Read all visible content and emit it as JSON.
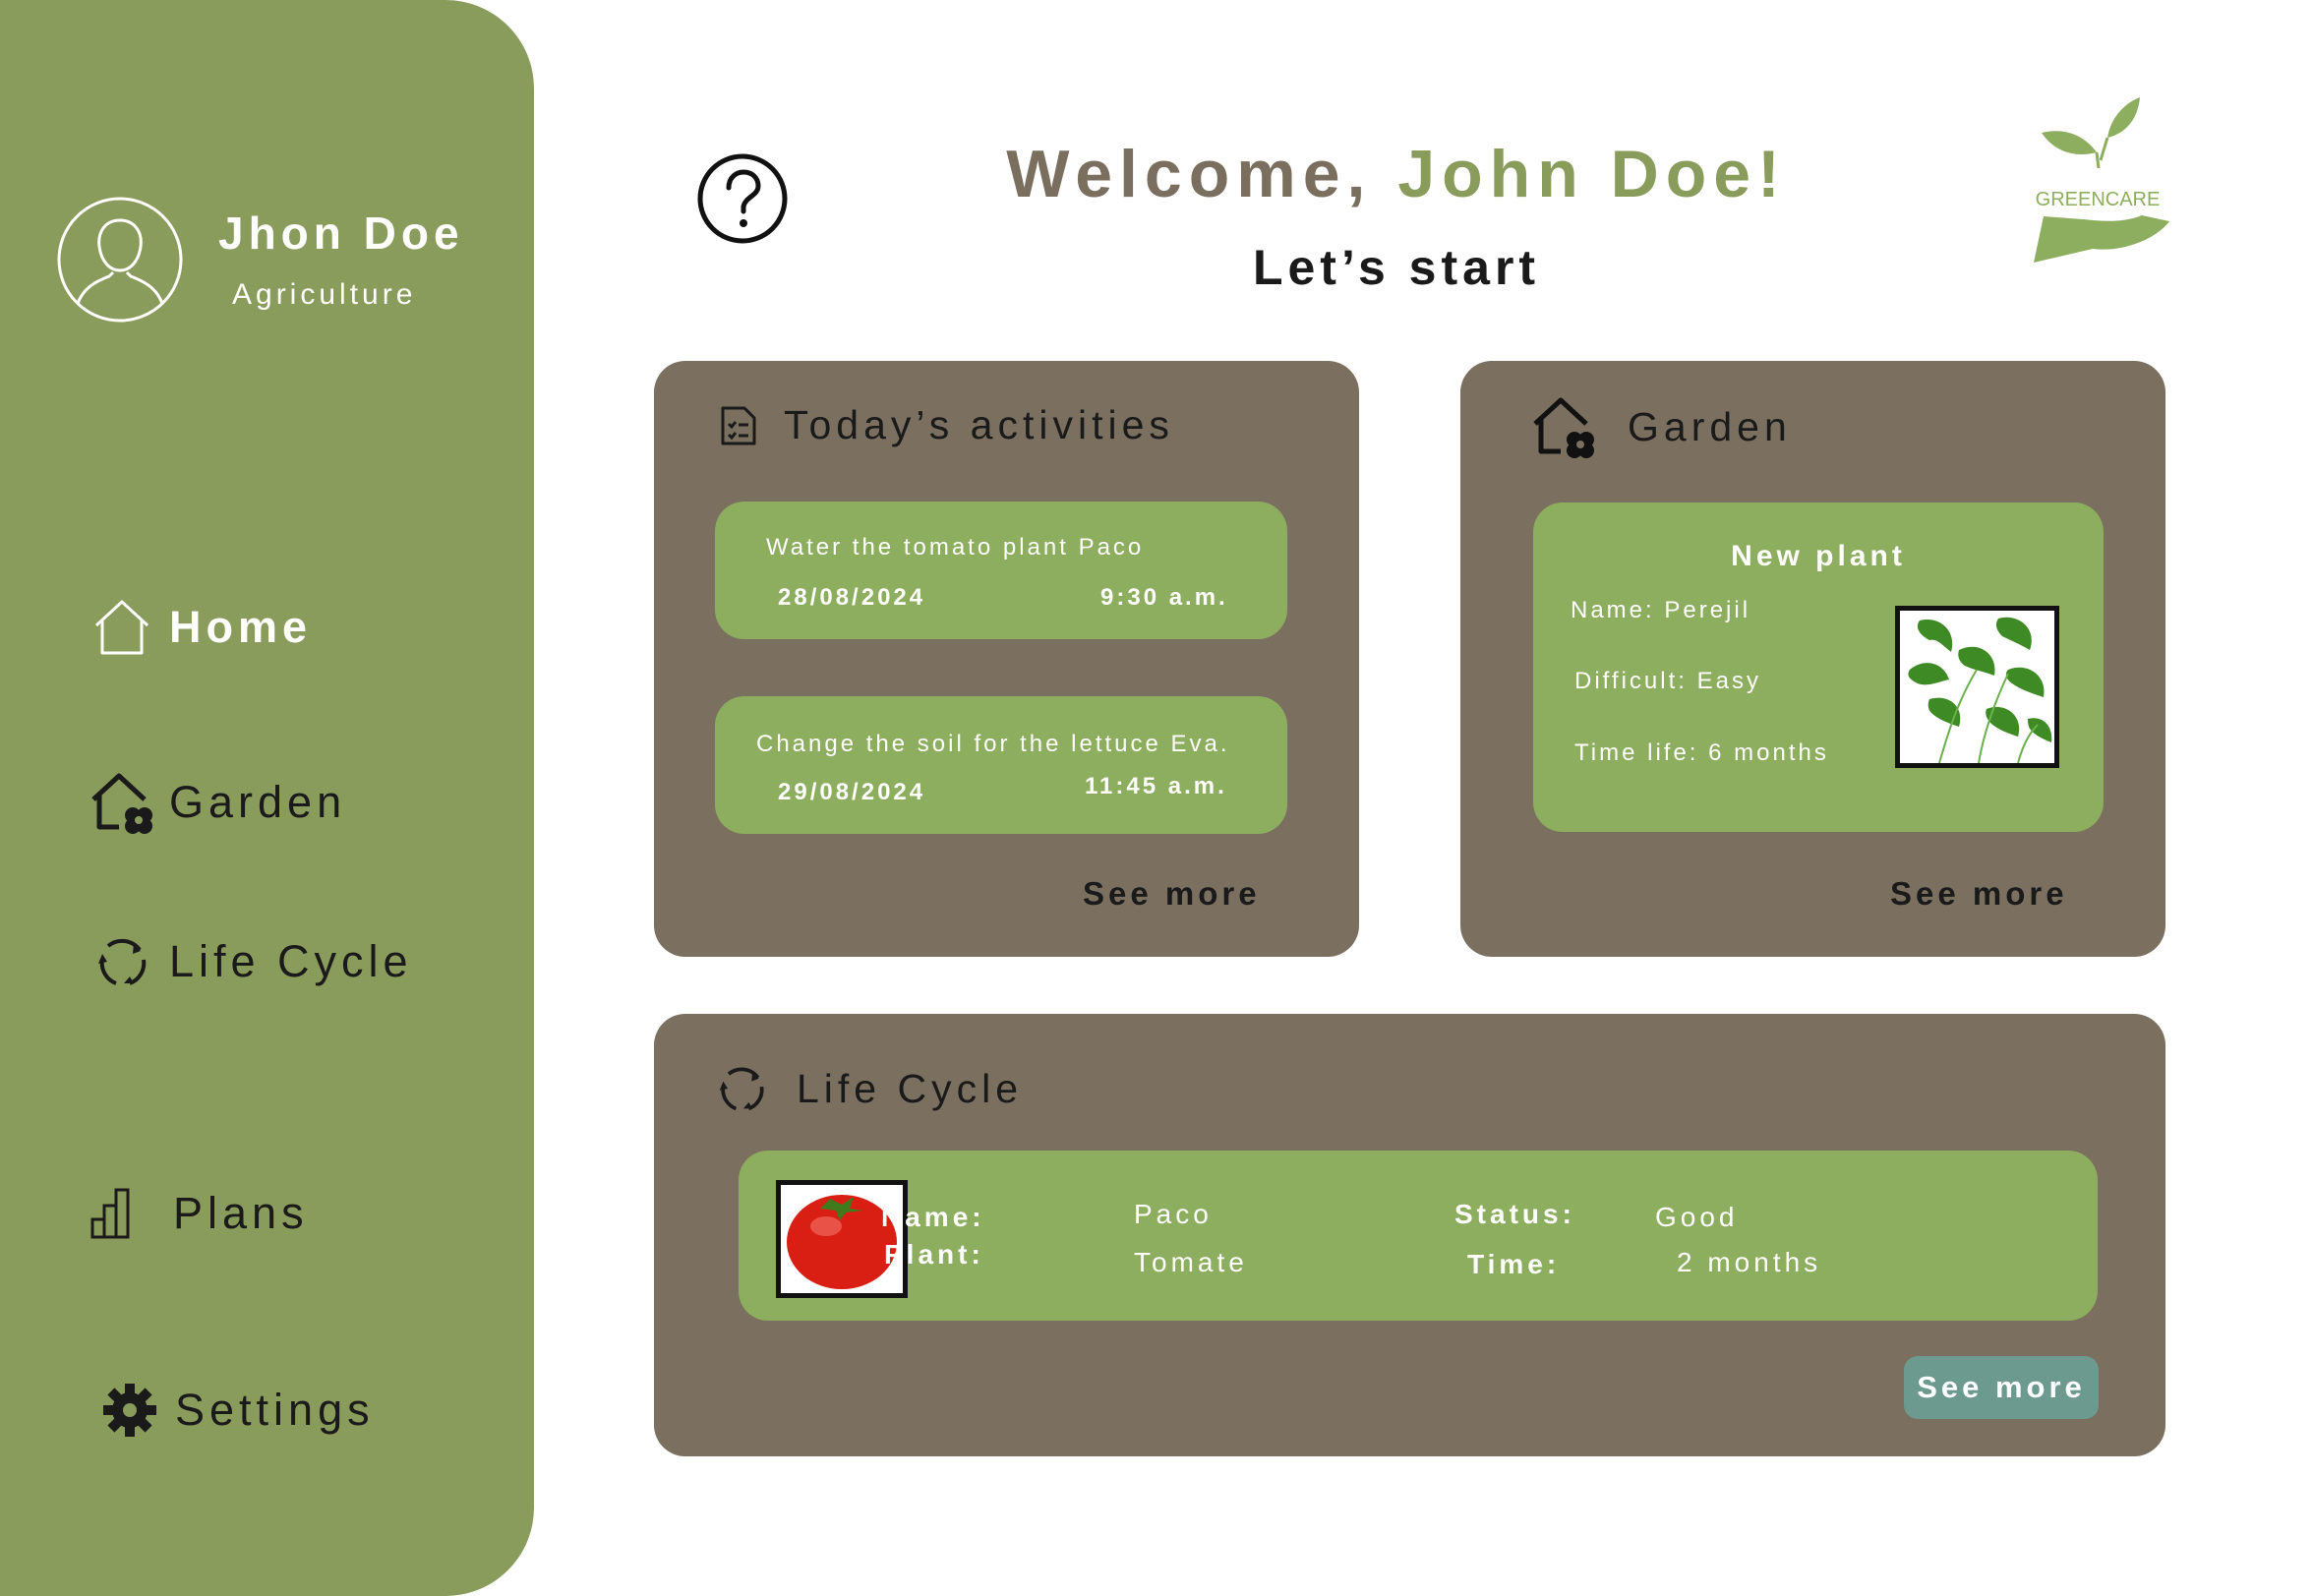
{
  "colors": {
    "sidebar": "#8a9c5b",
    "card": "#7b705f",
    "task": "#8dae5f",
    "accent": "#8a9c5b",
    "button": "#6c9a8e"
  },
  "sidebar": {
    "user": {
      "name": "Jhon Doe",
      "role": "Agriculture",
      "avatar_icon": "user-avatar-icon"
    },
    "items": [
      {
        "label": "Home",
        "icon": "home-icon",
        "active": true
      },
      {
        "label": "Garden",
        "icon": "garden-house-icon"
      },
      {
        "label": "Life Cycle",
        "icon": "recycle-icon"
      },
      {
        "label": "Plans",
        "icon": "bar-chart-icon"
      },
      {
        "label": "Settings",
        "icon": "gear-icon"
      }
    ]
  },
  "header": {
    "welcome_prefix": "Welcome, ",
    "welcome_name": "John Doe!",
    "subtitle": "Let’s start",
    "help_icon": "question-icon",
    "logo_text": "GREENCARE"
  },
  "activities": {
    "title": "Today’s activities",
    "icon": "checklist-icon",
    "tasks": [
      {
        "text": "Water the tomato plant Paco",
        "date": "28/08/2024",
        "time": "9:30 a.m."
      },
      {
        "text": "Change the soil for the lettuce Eva.",
        "date": "29/08/2024",
        "time": "11:45 a.m."
      }
    ],
    "see_more": "See more"
  },
  "garden": {
    "title": "Garden",
    "icon": "garden-house-icon",
    "new_plant": {
      "heading": "New plant",
      "name": "Name: Perejil",
      "difficulty": "Difficult: Easy",
      "time_life": "Time life: 6 months"
    },
    "see_more": "See more"
  },
  "life_cycle": {
    "title": "Life Cycle",
    "icon": "recycle-icon",
    "name_label": "Name:",
    "plant_label": "Plant:",
    "name_value": "Paco",
    "plant_value": "Tomate",
    "status_label": "Status:",
    "time_label": "Time:",
    "status_value": "Good",
    "time_value": "2 months",
    "see_more": "See more"
  }
}
